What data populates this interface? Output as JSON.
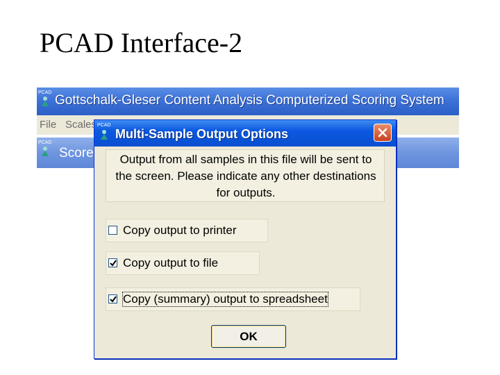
{
  "slide": {
    "title": "PCAD Interface-2"
  },
  "app_window": {
    "icon_label": "PCAD",
    "title": "Gottschalk-Gleser Content Analysis Computerized Scoring System",
    "menu": [
      "File",
      "Scales"
    ],
    "child_title": "Score"
  },
  "dialog": {
    "icon_label": "PCAD",
    "title": "Multi-Sample Output Options",
    "message_lines": [
      "Output from all samples in this file will be sent to",
      "the screen.  Please indicate any other destinations",
      "for outputs."
    ],
    "options": [
      {
        "label": "Copy output to printer",
        "checked": false
      },
      {
        "label": "Copy output to file",
        "checked": true
      },
      {
        "label": "Copy (summary) output to spreadsheet",
        "checked": true
      }
    ],
    "ok_label": "OK"
  },
  "colors": {
    "titlebar_blue": "#0b58e0",
    "dialog_face": "#ece9d8",
    "close_red": "#c8401f"
  }
}
